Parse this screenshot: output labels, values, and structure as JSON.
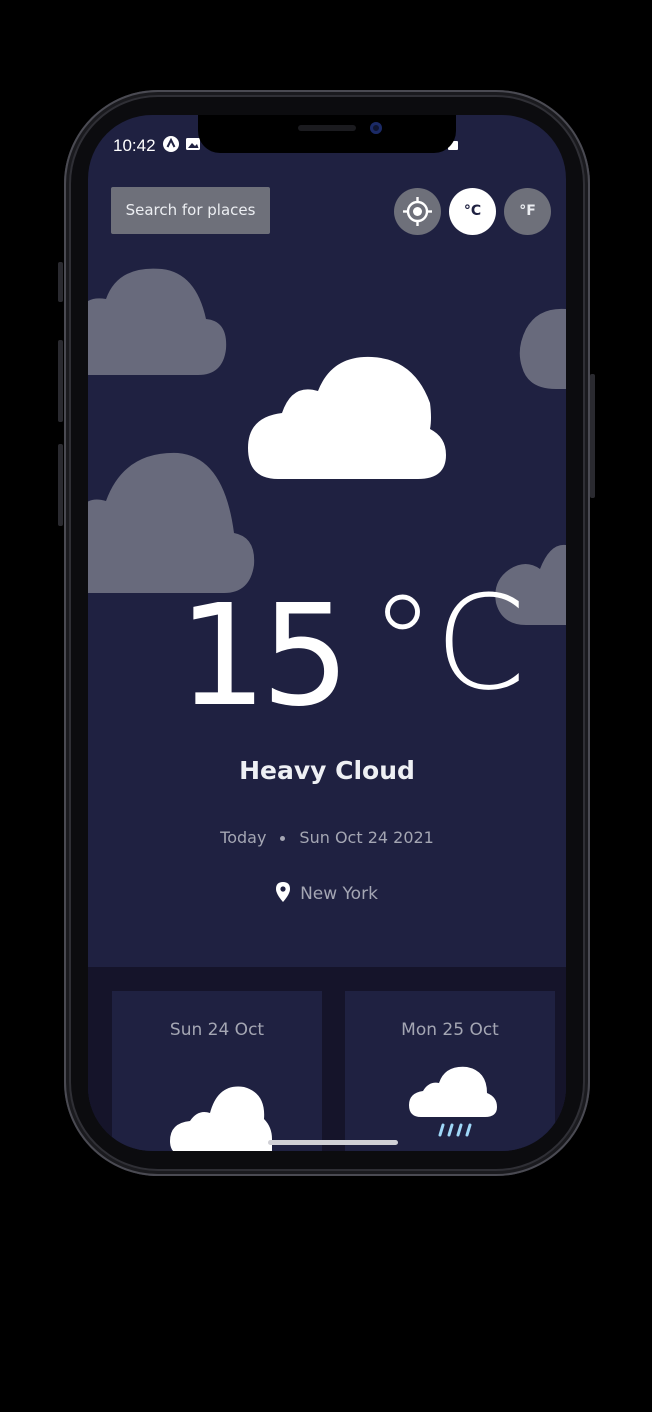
{
  "status_bar": {
    "time": "10:42"
  },
  "header": {
    "search_label": "Search for places",
    "location_icon": "crosshair-icon",
    "unit_celsius": "°C",
    "unit_fahrenheit": "°F",
    "selected_unit": "°C"
  },
  "current": {
    "temperature": "15",
    "unit": "°C",
    "condition": "Heavy Cloud",
    "day_label": "Today",
    "date": "Sun Oct 24 2021",
    "location": "New York",
    "icon": "heavy-cloud-icon"
  },
  "forecast": [
    {
      "day": "Sun 24 Oct",
      "icon": "cloud-icon"
    },
    {
      "day": "Mon 25 Oct",
      "icon": "rain-cloud-icon"
    }
  ],
  "colors": {
    "background": "#1f2141",
    "forecast_area": "#15142a",
    "button_gray": "#6e707a",
    "cloud_gray": "#686a7c",
    "text_secondary": "#a4a6b3"
  }
}
